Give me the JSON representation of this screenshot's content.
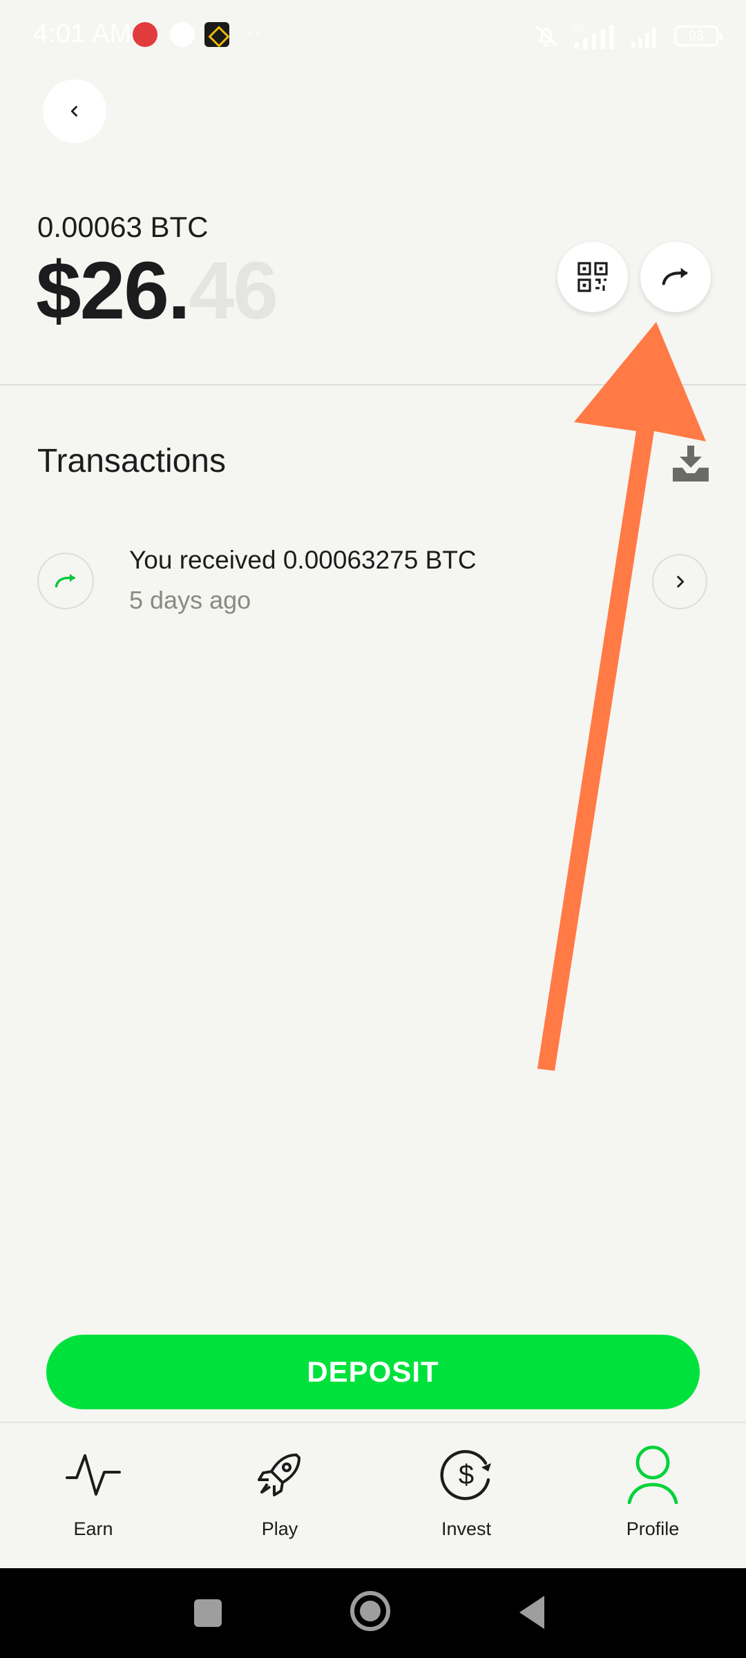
{
  "status_bar": {
    "time": "4:01 AM",
    "network": "5G",
    "battery": "93"
  },
  "balance": {
    "btc": "0.00063 BTC",
    "usd_whole": "$26.",
    "usd_cents": "46"
  },
  "transactions": {
    "title": "Transactions",
    "items": [
      {
        "title": "You received 0.00063275 BTC",
        "time": "5 days ago"
      }
    ]
  },
  "deposit_label": "DEPOSIT",
  "bottom_nav": {
    "items": [
      {
        "label": "Earn",
        "icon": "activity-icon"
      },
      {
        "label": "Play",
        "icon": "rocket-icon"
      },
      {
        "label": "Invest",
        "icon": "dollar-cycle-icon"
      },
      {
        "label": "Profile",
        "icon": "profile-icon",
        "active": true
      }
    ]
  },
  "colors": {
    "accent_green": "#00e13c",
    "annotation_orange": "#ff7a45",
    "background": "#f5f5f2"
  }
}
